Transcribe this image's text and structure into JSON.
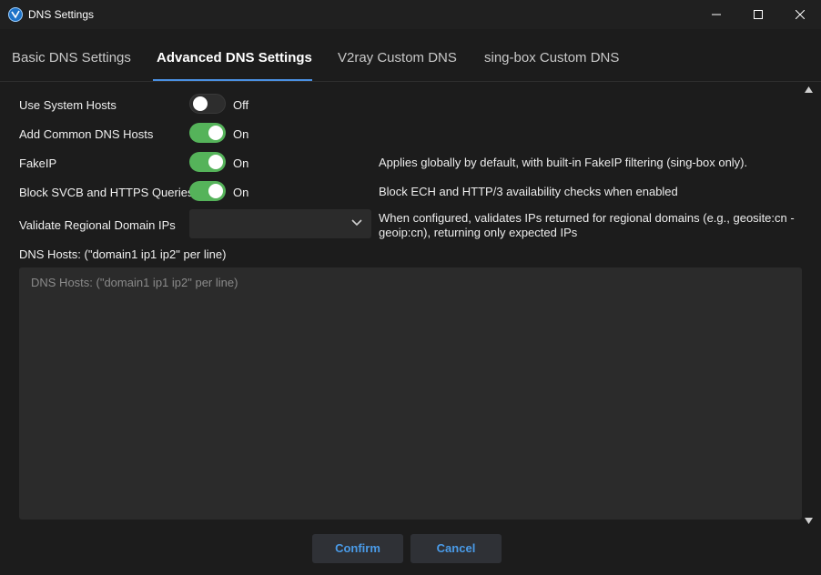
{
  "window": {
    "title": "DNS Settings",
    "icon": "app-logo-icon",
    "controls": [
      "minimize-icon",
      "maximize-icon",
      "close-icon"
    ]
  },
  "tabs": [
    {
      "label": "Basic DNS Settings",
      "active": false
    },
    {
      "label": "Advanced DNS Settings",
      "active": true
    },
    {
      "label": "V2ray Custom DNS",
      "active": false
    },
    {
      "label": "sing-box Custom DNS",
      "active": false
    }
  ],
  "settings": {
    "use_system_hosts": {
      "label": "Use System Hosts",
      "state": "Off"
    },
    "add_common_dns_hosts": {
      "label": "Add Common DNS Hosts",
      "state": "On"
    },
    "fakeip": {
      "label": "FakeIP",
      "state": "On",
      "description": "Applies globally by default, with built-in FakeIP filtering (sing-box only)."
    },
    "block_svcb": {
      "label": "Block SVCB and HTTPS Queries",
      "state": "On",
      "description": "Block ECH and HTTP/3 availability checks when enabled"
    },
    "validate_regional": {
      "label": "Validate Regional Domain IPs",
      "value": "",
      "description": "When configured, validates IPs returned for regional domains (e.g., geosite:cn - geoip:cn), returning only expected IPs"
    }
  },
  "dns_hosts": {
    "label": "DNS Hosts: (\"domain1 ip1 ip2\" per line)",
    "placeholder": "DNS Hosts: (\"domain1 ip1 ip2\" per line)",
    "value": ""
  },
  "buttons": {
    "confirm": "Confirm",
    "cancel": "Cancel"
  },
  "colors": {
    "accent": "#4a90e2",
    "toggle_on": "#55b35a",
    "button_text": "#4a9be8",
    "background": "#1c1c1c"
  }
}
